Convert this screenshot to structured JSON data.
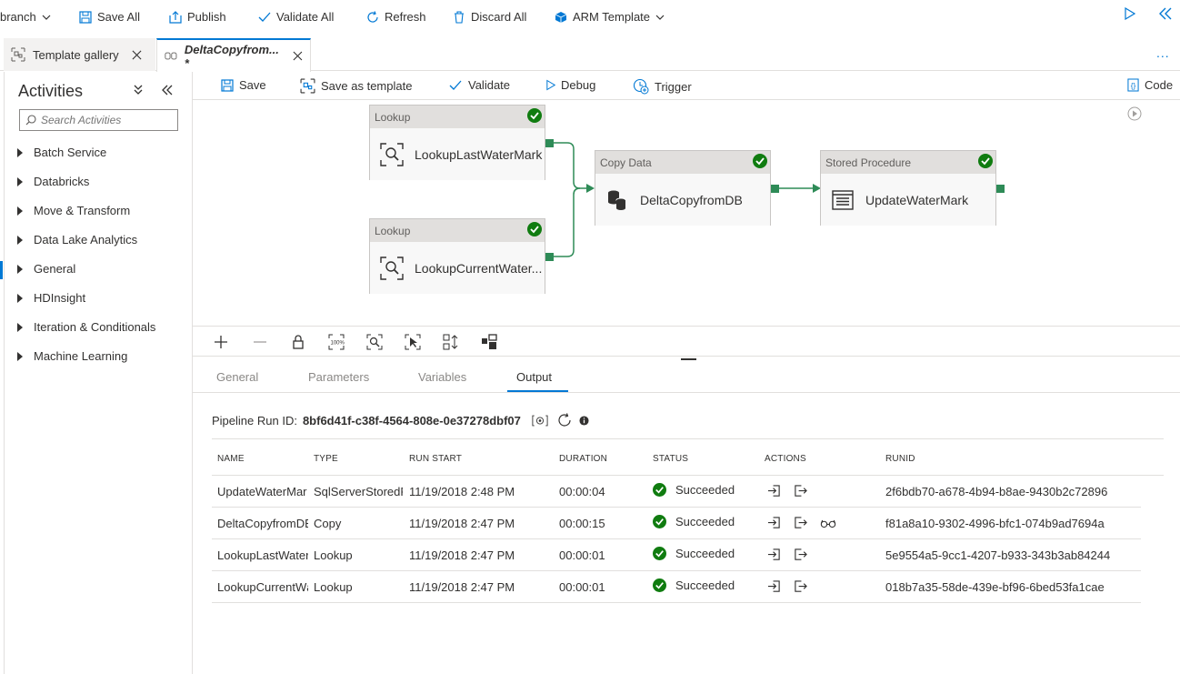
{
  "topbar": {
    "branch_label": "branch",
    "save_all": "Save All",
    "publish": "Publish",
    "validate_all": "Validate All",
    "refresh": "Refresh",
    "discard_all": "Discard All",
    "arm_template": "ARM Template"
  },
  "tabs": {
    "gallery": "Template gallery",
    "active": "DeltaCopyfrom... *",
    "more": "..."
  },
  "sidebar": {
    "title": "Activities",
    "search_placeholder": "Search Activities",
    "categories": [
      "Batch Service",
      "Databricks",
      "Move & Transform",
      "Data Lake Analytics",
      "General",
      "HDInsight",
      "Iteration & Conditionals",
      "Machine Learning"
    ]
  },
  "pipeline_toolbar": {
    "save": "Save",
    "save_as_template": "Save as template",
    "validate": "Validate",
    "debug": "Debug",
    "trigger": "Trigger",
    "code": "Code"
  },
  "nodes": [
    {
      "type": "Lookup",
      "name": "LookupLastWaterMark",
      "icon": "lookup-icon"
    },
    {
      "type": "Lookup",
      "name": "LookupCurrentWater...",
      "icon": "lookup-icon"
    },
    {
      "type": "Copy Data",
      "name": "DeltaCopyfromDB",
      "icon": "copy-data-icon"
    },
    {
      "type": "Stored Procedure",
      "name": "UpdateWaterMark",
      "icon": "stored-procedure-icon"
    }
  ],
  "bottom_tabs": [
    "General",
    "Parameters",
    "Variables",
    "Output"
  ],
  "output": {
    "run_id_label": "Pipeline Run ID:",
    "run_id": "8bf6d41f-c38f-4564-808e-0e37278dbf07",
    "columns": [
      "NAME",
      "TYPE",
      "RUN START",
      "DURATION",
      "STATUS",
      "ACTIONS",
      "RUNID"
    ],
    "rows": [
      {
        "name": "UpdateWaterMar",
        "type": "SqlServerStoredP",
        "start": "11/19/2018 2:48 PM",
        "duration": "00:00:04",
        "status": "Succeeded",
        "runid": "2f6bdb70-a678-4b94-b8ae-9430b2c72896",
        "details": false
      },
      {
        "name": "DeltaCopyfromDE",
        "type": "Copy",
        "start": "11/19/2018 2:47 PM",
        "duration": "00:00:15",
        "status": "Succeeded",
        "runid": "f81a8a10-9302-4996-bfc1-074b9ad7694a",
        "details": true
      },
      {
        "name": "LookupLastWater",
        "type": "Lookup",
        "start": "11/19/2018 2:47 PM",
        "duration": "00:00:01",
        "status": "Succeeded",
        "runid": "5e9554a5-9cc1-4207-b933-343b3ab84244",
        "details": false
      },
      {
        "name": "LookupCurrentWá",
        "type": "Lookup",
        "start": "11/19/2018 2:47 PM",
        "duration": "00:00:01",
        "status": "Succeeded",
        "runid": "018b7a35-58de-439e-bf96-6bed53fa1cae",
        "details": false
      }
    ]
  },
  "colors": {
    "accent": "#0078d4",
    "success": "#107c10",
    "port": "#2e8b57"
  }
}
